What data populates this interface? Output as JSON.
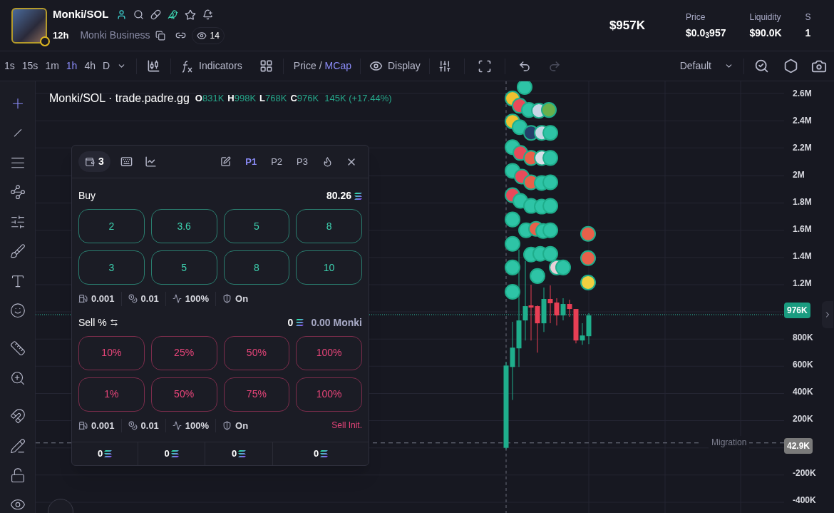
{
  "header": {
    "symbol": "Monki/SOL",
    "age": "12h",
    "name": "Monki Business",
    "watchers": "14",
    "market_cap": "$957K",
    "stats": [
      {
        "label": "Price",
        "value": "$0.0$_{3}$957"
      },
      {
        "label": "Liquidity",
        "value": "$90.0K"
      },
      {
        "label": "S",
        "value": "1"
      }
    ]
  },
  "toolbar": {
    "intervals": [
      {
        "label": "1s",
        "selected": false
      },
      {
        "label": "15s",
        "selected": false
      },
      {
        "label": "1m",
        "selected": false
      },
      {
        "label": "1h",
        "selected": true
      },
      {
        "label": "4h",
        "selected": false
      },
      {
        "label": "D",
        "selected": false
      }
    ],
    "indicators": "Indicators",
    "price_toggle": [
      {
        "label": "Price",
        "selected": false
      },
      {
        "label": "MCap",
        "selected": true
      }
    ],
    "separator": "/",
    "display": "Display",
    "layout": "Default",
    "redo_disabled": true
  },
  "chart": {
    "legend": {
      "title": "Monki/SOL · trade.padre.gg",
      "ohlc": [
        {
          "key": "O",
          "value": "831K"
        },
        {
          "key": "H",
          "value": "998K"
        },
        {
          "key": "L",
          "value": "768K"
        },
        {
          "key": "C",
          "value": "976K"
        }
      ],
      "change": "145K (+17.44%)"
    },
    "y_axis": [
      {
        "kind": "tick",
        "label": "2.6M"
      },
      {
        "kind": "tick",
        "label": "2.4M"
      },
      {
        "kind": "tick",
        "label": "2.2M"
      },
      {
        "kind": "tick",
        "label": "2M"
      },
      {
        "kind": "tick",
        "label": "1.8M"
      },
      {
        "kind": "tick",
        "label": "1.6M"
      },
      {
        "kind": "tick",
        "label": "1.4M"
      },
      {
        "kind": "tick",
        "label": "1.2M"
      },
      {
        "kind": "price",
        "label": "976K"
      },
      {
        "kind": "tick",
        "label": "800K"
      },
      {
        "kind": "tick",
        "label": "600K"
      },
      {
        "kind": "tick",
        "label": "400K"
      },
      {
        "kind": "tick",
        "label": "200K"
      },
      {
        "kind": "migration",
        "label": "42.9K"
      },
      {
        "kind": "tick",
        "label": "-200K"
      },
      {
        "kind": "tick",
        "label": "-400K"
      }
    ],
    "migration_label": "Migration"
  },
  "trade_panel": {
    "wallets": "3",
    "presets": [
      {
        "label": "P1",
        "selected": true
      },
      {
        "label": "P2",
        "selected": false
      },
      {
        "label": "P3",
        "selected": false
      }
    ],
    "buy": {
      "label": "Buy",
      "balance": "80.26",
      "amounts": [
        "2",
        "3.6",
        "5",
        "8",
        "3",
        "5",
        "8",
        "10"
      ],
      "settings": [
        {
          "kind": "gas",
          "value": "0.001"
        },
        {
          "kind": "tip",
          "value": "0.01"
        },
        {
          "kind": "slippage",
          "value": "100%"
        },
        {
          "kind": "protection",
          "value": "On"
        }
      ]
    },
    "sell": {
      "label": "Sell %",
      "held": "0",
      "token_amount": "0.00 Monki",
      "amounts": [
        "10%",
        "25%",
        "50%",
        "100%",
        "1%",
        "50%",
        "75%",
        "100%"
      ],
      "settings": [
        {
          "kind": "gas",
          "value": "0.001"
        },
        {
          "kind": "tip",
          "value": "0.01"
        },
        {
          "kind": "slippage",
          "value": "100%"
        },
        {
          "kind": "protection",
          "value": "On"
        }
      ],
      "action": "Sell Init."
    },
    "footer": [
      "0",
      "0",
      "0",
      "0"
    ]
  }
}
